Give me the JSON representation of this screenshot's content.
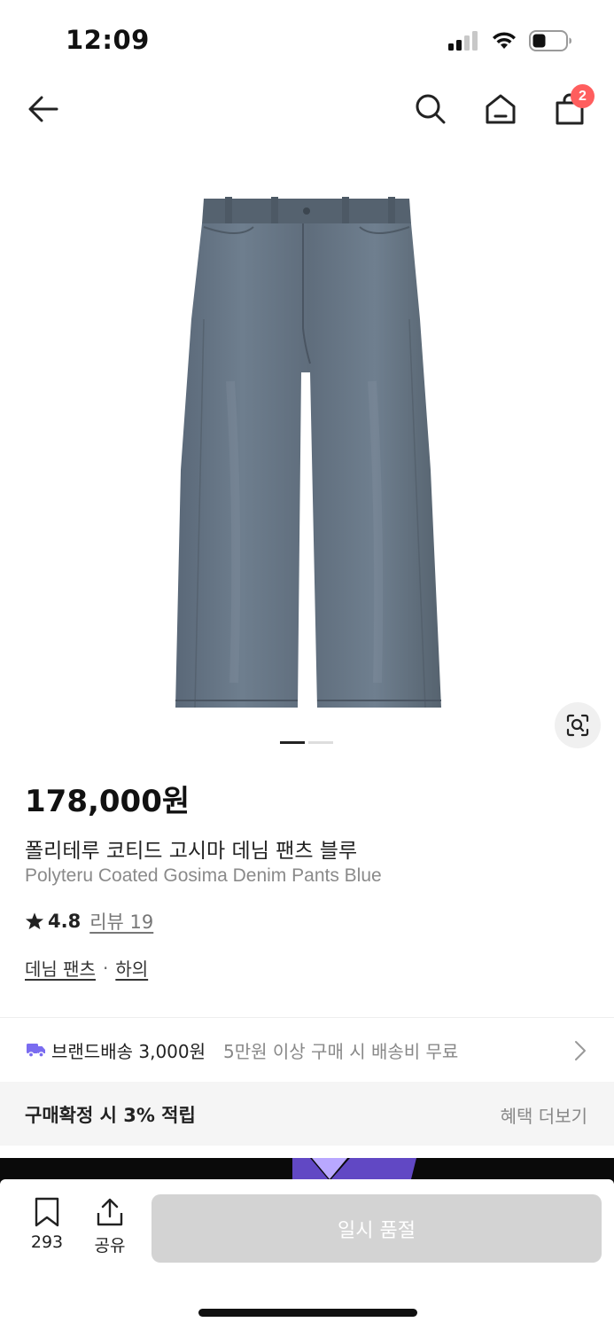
{
  "status_bar": {
    "time": "12:09"
  },
  "nav": {
    "back_icon": "arrow-left-icon",
    "search_icon": "search-icon",
    "home_icon": "home-icon",
    "cart_icon": "shopping-bag-icon",
    "cart_count": "2"
  },
  "gallery": {
    "pages": 2,
    "active_page": 1
  },
  "product": {
    "price": "178,000원",
    "name_ko": "폴리테루 코티드 고시마 데님 팬츠 블루",
    "name_en": "Polyteru Coated Gosima Denim Pants Blue",
    "rating": "4.8",
    "review_label": "리뷰 19",
    "categories": [
      "데님 팬츠",
      "하의"
    ],
    "category_separator": "·"
  },
  "shipping": {
    "label": "브랜드배송 3,000원",
    "sub": "5만원 이상 구매 시 배송비 무료"
  },
  "benefit": {
    "label": "구매확정 시 3% 적립",
    "more": "혜택 더보기"
  },
  "bottom_bar": {
    "wishlist_count": "293",
    "share_label": "공유",
    "buy_button": "일시 품절"
  },
  "colors": {
    "badge": "#ff5e5e",
    "truck": "#7a6cf0",
    "soldout_button": "#d3d3d3"
  }
}
